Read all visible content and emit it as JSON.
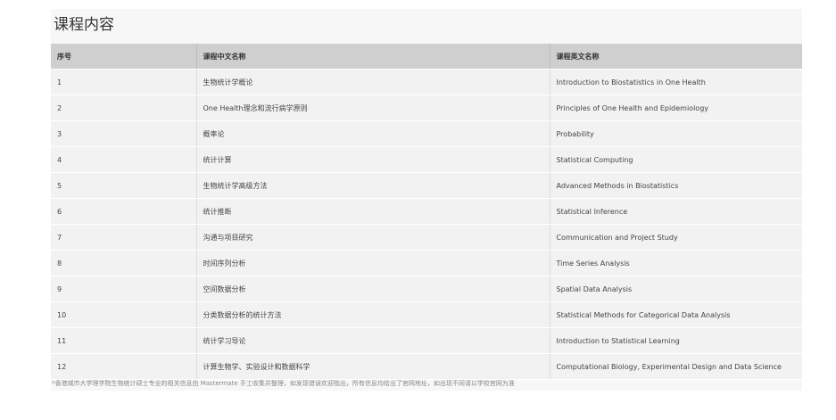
{
  "section": {
    "title": "课程内容"
  },
  "table": {
    "headers": {
      "no": "序号",
      "cn": "课程中文名称",
      "en": "课程英文名称"
    },
    "rows": [
      {
        "no": "1",
        "cn": "生物统计学概论",
        "en": "Introduction to Biostatistics in One Health"
      },
      {
        "no": "2",
        "cn": "One Health理念和流行病学原则",
        "en": "Principles of One Health and Epidemiology"
      },
      {
        "no": "3",
        "cn": "概率论",
        "en": "Probability"
      },
      {
        "no": "4",
        "cn": "统计计算",
        "en": "Statistical Computing"
      },
      {
        "no": "5",
        "cn": "生物统计学高级方法",
        "en": "Advanced Methods in Biostatistics"
      },
      {
        "no": "6",
        "cn": "统计推断",
        "en": "Statistical Inference"
      },
      {
        "no": "7",
        "cn": "沟通与项目研究",
        "en": "Communication and Project Study"
      },
      {
        "no": "8",
        "cn": "时间序列分析",
        "en": "Time Series Analysis"
      },
      {
        "no": "9",
        "cn": "空间数据分析",
        "en": "Spatial Data Analysis"
      },
      {
        "no": "10",
        "cn": "分类数据分析的统计方法",
        "en": "Statistical Methods for Categorical Data Analysis"
      },
      {
        "no": "11",
        "cn": "统计学习导论",
        "en": "Introduction to Statistical Learning"
      },
      {
        "no": "12",
        "cn": "计算生物学、实验设计和数据科学",
        "en": "Computational Biology, Experimental Design and Data Science"
      }
    ]
  },
  "footnote": "*香港城市大学理学院生物统计硕士专业的相关信息由 Mastermate 手工收集并整理，如发现错误欢迎指出，所有信息均给出了官网地址，如出现不同请以学校官网为准"
}
